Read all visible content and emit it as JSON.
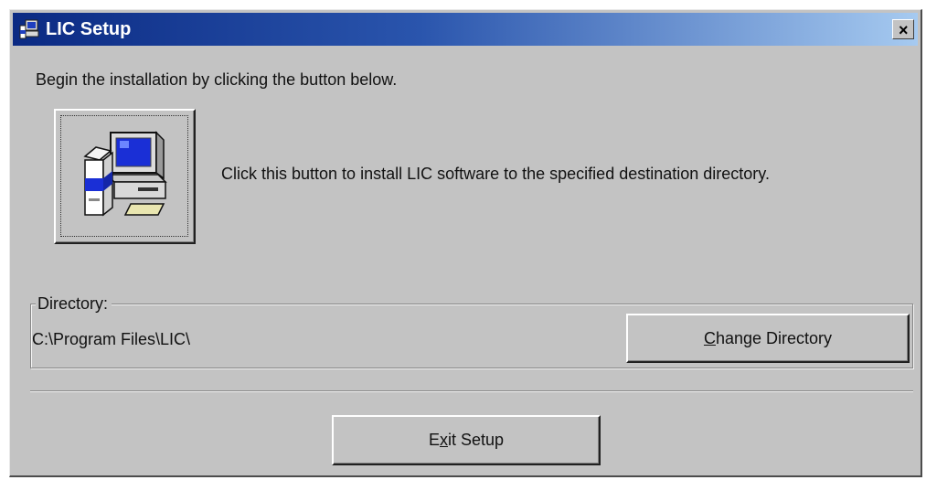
{
  "window": {
    "title": "LIC Setup",
    "close_label": "×"
  },
  "intro_text": "Begin the installation by clicking the button below.",
  "install": {
    "description": "Click this button to install LIC software to the specified destination directory."
  },
  "directory": {
    "legend": "Directory:",
    "path": "C:\\Program Files\\LIC\\",
    "change_button": {
      "mnemonic": "C",
      "rest": "hange Directory"
    }
  },
  "exit_button": {
    "before": "E",
    "mnemonic": "x",
    "after": "it Setup"
  },
  "colors": {
    "titlebar_start": "#0b2a83",
    "titlebar_end": "#a6caf0",
    "dialog_face": "#c3c3c3"
  },
  "icons": {
    "app": "computer-install-icon",
    "install_button": "computer-with-box-icon"
  }
}
